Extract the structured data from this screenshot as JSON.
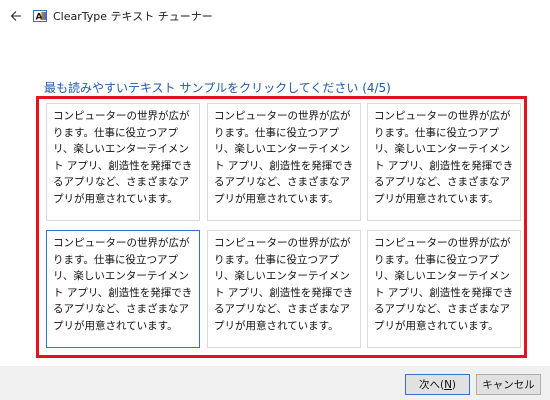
{
  "window": {
    "title": "ClearType テキスト チューナー",
    "back_icon": "back-arrow-icon",
    "app_icon": "cleartype-icon"
  },
  "heading": "最も読みやすいテキスト サンプルをクリックしてください (4/5)",
  "samples": [
    {
      "text": "コンピューターの世界が広がります。仕事に役立つアプリ、楽しいエンターテイメント アプリ、創造性を発揮できるアプリなど、さまざまなアプリが用意されています。",
      "selected": false
    },
    {
      "text": "コンピューターの世界が広がります。仕事に役立つアプリ、楽しいエンターテイメント アプリ、創造性を発揮できるアプリなど、さまざまなアプリが用意されています。",
      "selected": false
    },
    {
      "text": "コンピューターの世界が広がります。仕事に役立つアプリ、楽しいエンターテイメント アプリ、創造性を発揮できるアプリなど、さまざまなアプリが用意されています。",
      "selected": false
    },
    {
      "text": "コンピューターの世界が広がります。仕事に役立つアプリ、楽しいエンターテイメント アプリ、創造性を発揮できるアプリなど、さまざまなアプリが用意されています。",
      "selected": true
    },
    {
      "text": "コンピューターの世界が広がります。仕事に役立つアプリ、楽しいエンターテイメント アプリ、創造性を発揮できるアプリなど、さまざまなアプリが用意されています。",
      "selected": false
    },
    {
      "text": "コンピューターの世界が広がります。仕事に役立つアプリ、楽しいエンターテイメント アプリ、創造性を発揮できるアプリなど、さまざまなアプリが用意されています。",
      "selected": false
    }
  ],
  "buttons": {
    "next_label": "次へ(",
    "next_key": "N",
    "next_suffix": ")",
    "cancel_label": "キャンセル"
  },
  "colors": {
    "heading": "#1f5aa8",
    "highlight_frame": "#e3121d",
    "selected_border": "#2d76c8"
  }
}
